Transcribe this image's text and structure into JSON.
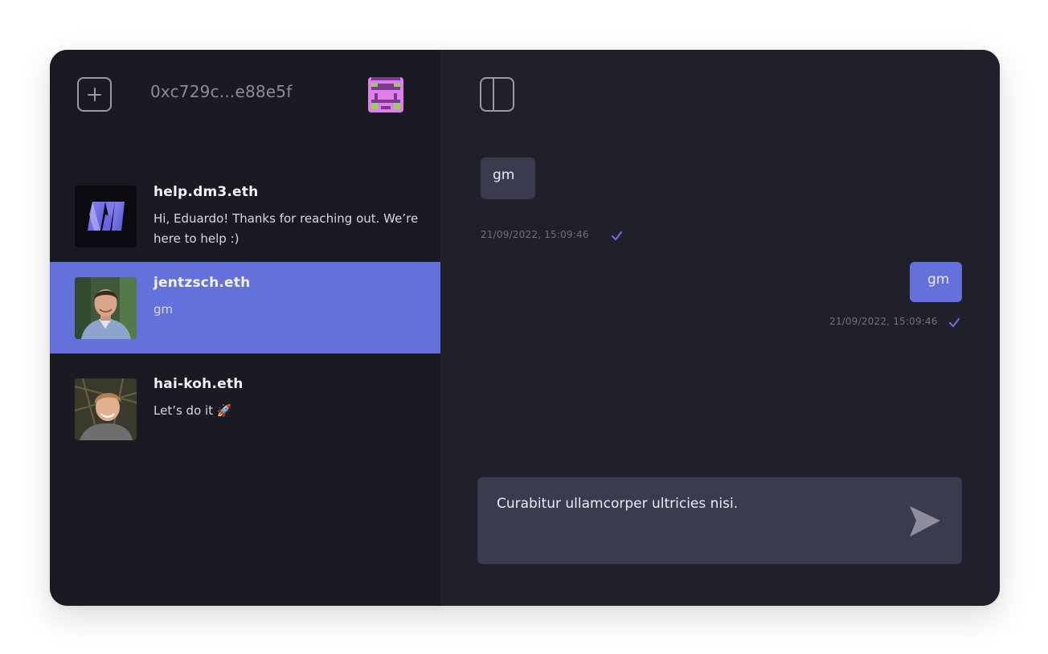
{
  "colors": {
    "accent": "#6571db",
    "sidebar_bg": "#1a1a23",
    "main_bg": "#20202b",
    "bubble_incoming": "#3b3b50",
    "muted_text": "#70707e"
  },
  "sidebar": {
    "new_chat_icon": "plus-square-icon",
    "account_address": "0xc729c...e88e5f",
    "account_avatar": "pixel-identicon",
    "contacts": [
      {
        "name": "help.dm3.eth",
        "preview": "Hi, Eduardo! Thanks for reaching out. We’re here to help :)",
        "avatar": "dm3-logo",
        "selected": false
      },
      {
        "name": "jentzsch.eth",
        "preview": "gm",
        "avatar": "profile-photo",
        "selected": true
      },
      {
        "name": "hai-koh.eth",
        "preview": "Let’s do it 🚀",
        "avatar": "profile-photo",
        "selected": false
      }
    ]
  },
  "main": {
    "panel_toggle_icon": "sidebar-toggle-icon",
    "messages": [
      {
        "direction": "incoming",
        "text": "gm",
        "timestamp": "21/09/2022, 15:09:46",
        "status_icon": "check-icon"
      },
      {
        "direction": "outgoing",
        "text": "gm",
        "timestamp": "21/09/2022, 15:09:46",
        "status_icon": "check-icon"
      }
    ],
    "composer": {
      "value": "Curabitur ullamcorper ultricies nisi.",
      "send_icon": "send-icon"
    }
  }
}
